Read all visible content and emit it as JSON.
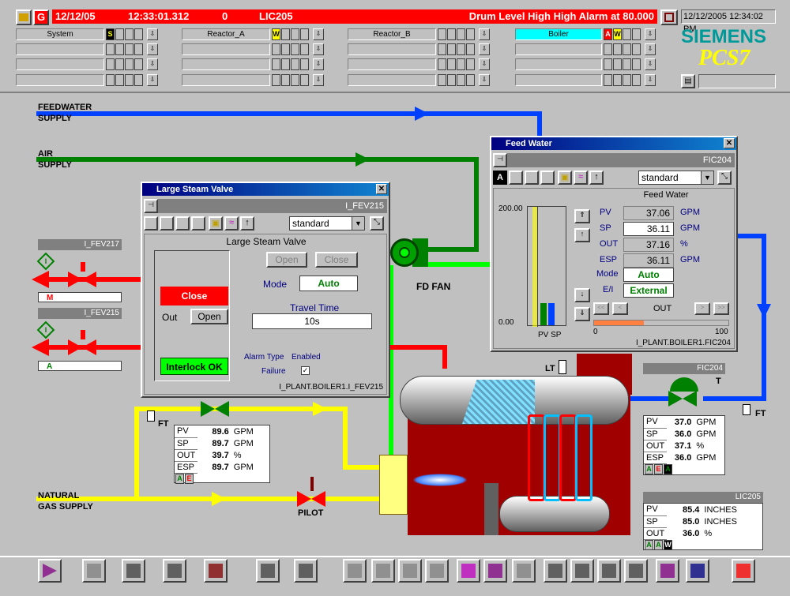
{
  "alarm_bar": {
    "date": "12/12/05",
    "time": "12:33:01.312",
    "count": "0",
    "tag": "LIC205",
    "message": "Drum Level High High Alarm at 80.000",
    "datetime": "12/12/2005 12:34:02 PM"
  },
  "areas": [
    {
      "label": "System",
      "indicators": [
        "S"
      ]
    },
    {
      "label": "Reactor_A",
      "indicators": [
        "W"
      ]
    },
    {
      "label": "Reactor_B",
      "indicators": []
    },
    {
      "label": "Boiler",
      "indicators": [
        "A",
        "W"
      ]
    }
  ],
  "brand": {
    "siemens": "SIEMENS",
    "product": "PCS7"
  },
  "process": {
    "feedwater_line1": "FEEDWATER",
    "feedwater_line2": "SUPPLY",
    "air_line1": "AIR",
    "air_line2": "SUPPLY",
    "gas_line1": "NATURAL",
    "gas_line2": "GAS SUPPLY",
    "fd_fan": "FD FAN",
    "pilot": "PILOT",
    "ft_left": "FT",
    "ft_right": "FT",
    "lt": "LT",
    "t_label": "T",
    "valve1_tag": "I_FEV217",
    "valve1_status": "M",
    "valve2_tag": "I_FEV215",
    "valve2_status": "A",
    "interlock_symbol": "I"
  },
  "steam_valve_window": {
    "title": "Large Steam Valve",
    "tag": "I_FEV215",
    "view": "standard",
    "subtitle": "Large Steam Valve",
    "open_btn": "Open",
    "close_btn": "Close",
    "mode_label": "Mode",
    "mode_value": "Auto",
    "state": "Close",
    "out_label": "Out",
    "out_btn": "Open",
    "travel_label": "Travel Time",
    "travel_value": "10s",
    "interlock": "Interlock OK",
    "alarm_type": "Alarm Type",
    "enabled": "Enabled",
    "failure": "Failure",
    "check": "✓",
    "path": "I_PLANT.BOILER1.I_FEV215"
  },
  "feed_water_window": {
    "title": "Feed Water",
    "tag": "FIC204",
    "view": "standard",
    "subtitle": "Feed Water",
    "auth": "A",
    "scale_max": "200.00",
    "scale_min": "0.00",
    "bar_labels": "PV SP",
    "pv_label": "PV",
    "pv_value": "37.06",
    "pv_unit": "GPM",
    "sp_label": "SP",
    "sp_value": "36.11",
    "sp_unit": "GPM",
    "out_label": "OUT",
    "out_value": "37.16",
    "out_unit": "%",
    "esp_label": "ESP",
    "esp_value": "36.11",
    "esp_unit": "GPM",
    "mode_label": "Mode",
    "mode_value": "Auto",
    "ei_label": "E/I",
    "ei_value": "External",
    "out_caption": "OUT",
    "out_min": "0",
    "out_max": "100",
    "out_fill": 0.37,
    "path": "I_PLANT.BOILER1.FIC204"
  },
  "ft_left_panel": {
    "rows": [
      {
        "label": "PV",
        "value": "89.6",
        "unit": "GPM"
      },
      {
        "label": "SP",
        "value": "89.7",
        "unit": "GPM"
      },
      {
        "label": "OUT",
        "value": "39.7",
        "unit": "%"
      },
      {
        "label": "ESP",
        "value": "89.7",
        "unit": "GPM"
      }
    ],
    "status": [
      "A",
      "E"
    ]
  },
  "fic204_panel": {
    "tag": "FIC204",
    "rows": [
      {
        "label": "PV",
        "value": "37.0",
        "unit": "GPM"
      },
      {
        "label": "SP",
        "value": "36.0",
        "unit": "GPM"
      },
      {
        "label": "OUT",
        "value": "37.1",
        "unit": "%"
      },
      {
        "label": "ESP",
        "value": "36.0",
        "unit": "GPM"
      }
    ],
    "status": [
      "A",
      "E",
      "A"
    ]
  },
  "lic205_panel": {
    "tag": "LIC205",
    "rows": [
      {
        "label": "PV",
        "value": "85.4",
        "unit": "INCHES"
      },
      {
        "label": "SP",
        "value": "85.0",
        "unit": "INCHES"
      },
      {
        "label": "OUT",
        "value": "36.0",
        "unit": "%"
      }
    ],
    "status": [
      "A",
      "A",
      "W"
    ]
  },
  "colors": {
    "alarm_red": "#ff0000",
    "feedwater": "#0040ff",
    "air": "#008000",
    "gas": "#ffff00",
    "steam": "#ff0000",
    "boiler": "#a00000"
  }
}
